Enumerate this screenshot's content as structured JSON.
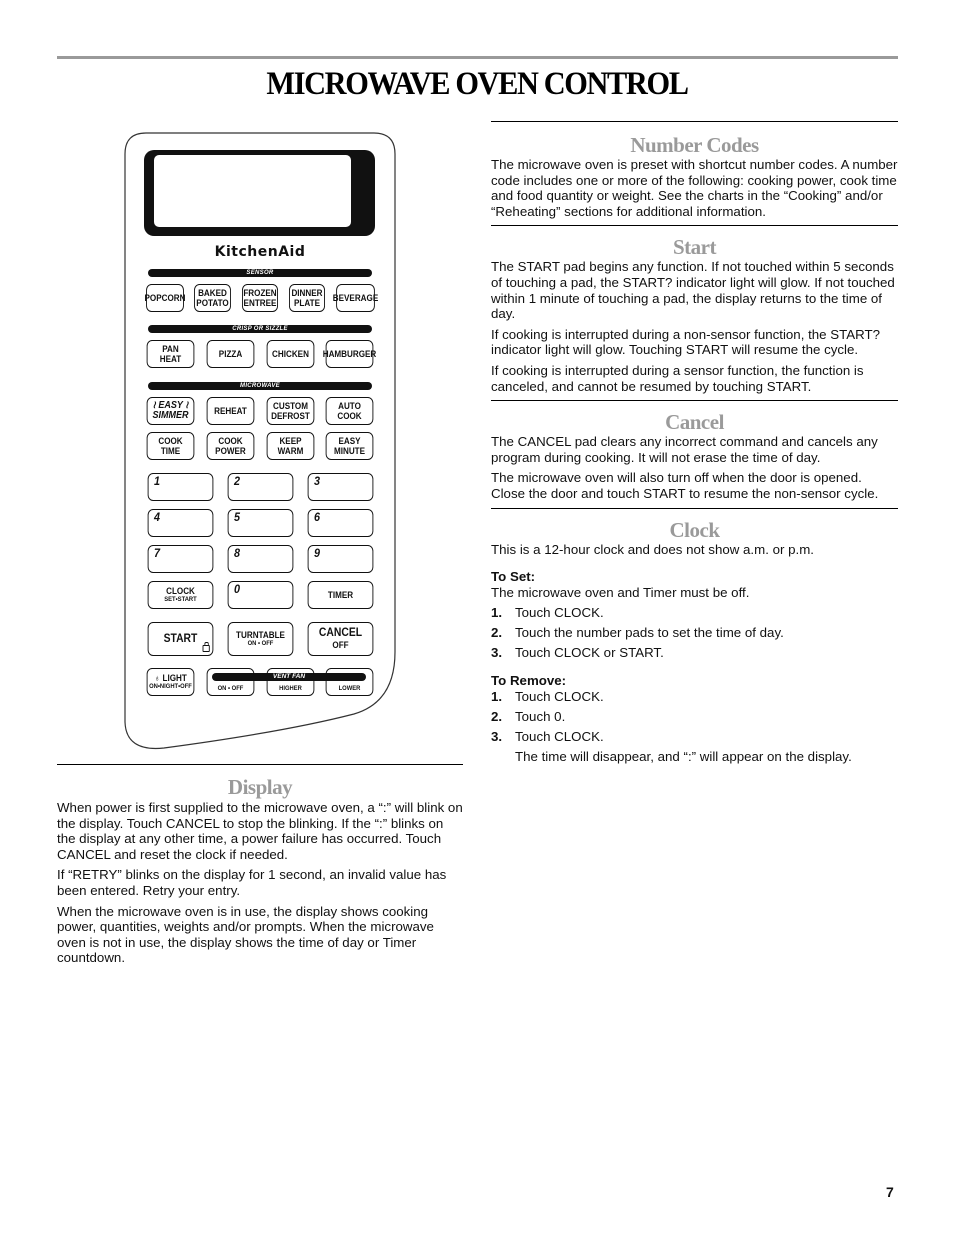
{
  "page": {
    "title": "MICROWAVE OVEN CONTROL",
    "page_number": "7"
  },
  "keypad": {
    "brand": "KitchenAid",
    "bands": {
      "sensor": "SENSOR",
      "crisp": "CRISP OR SIZZLE",
      "microwave": "MICROWAVE",
      "vent_fan": "VENT FAN"
    },
    "sensor_keys": [
      {
        "l1": "POPCORN",
        "l2": ""
      },
      {
        "l1": "BAKED",
        "l2": "POTATO"
      },
      {
        "l1": "FROZEN",
        "l2": "ENTREE"
      },
      {
        "l1": "DINNER",
        "l2": "PLATE"
      },
      {
        "l1": "BEVERAGE",
        "l2": ""
      }
    ],
    "crisp_keys": [
      {
        "l1": "PAN",
        "l2": "HEAT"
      },
      {
        "l1": "PIZZA",
        "l2": ""
      },
      {
        "l1": "CHICKEN",
        "l2": ""
      },
      {
        "l1": "HAMBURGER",
        "l2": ""
      }
    ],
    "microwave_keys_row1": [
      {
        "l1": "≀ EASY ≀",
        "l2": "SIMMER"
      },
      {
        "l1": "REHEAT",
        "l2": ""
      },
      {
        "l1": "CUSTOM",
        "l2": "DEFROST"
      },
      {
        "l1": "AUTO",
        "l2": "COOK"
      }
    ],
    "microwave_keys_row2": [
      {
        "l1": "COOK",
        "l2": "TIME"
      },
      {
        "l1": "COOK",
        "l2": "POWER"
      },
      {
        "l1": "KEEP",
        "l2": "WARM"
      },
      {
        "l1": "EASY",
        "l2": "MINUTE"
      }
    ],
    "numbers": [
      "1",
      "2",
      "3",
      "4",
      "5",
      "6",
      "7",
      "8",
      "9",
      "0"
    ],
    "clock": {
      "l1": "CLOCK",
      "l2": "SET•START"
    },
    "timer": "TIMER",
    "start": "START",
    "turntable": {
      "l1": "TURNTABLE",
      "l2": "ON • OFF"
    },
    "cancel": {
      "l1": "CANCEL",
      "l2": "OFF"
    },
    "light": {
      "l1": "LIGHT",
      "l2": "ON•NIGHT•OFF"
    },
    "vent_keys": [
      "ON • OFF",
      "HIGHER",
      "LOWER"
    ]
  },
  "display": {
    "title": "Display",
    "paragraphs": [
      "When power is first supplied to the microwave oven, a “:” will blink on the display. Touch CANCEL to stop the blinking. If the “:” blinks on the display at any other time, a power failure has occurred. Touch CANCEL and reset the clock if needed.",
      "If “RETRY” blinks on the display for 1 second, an invalid value has been entered. Retry your entry.",
      "When the microwave oven is in use, the display shows cooking power, quantities, weights and/or prompts. When the microwave oven is not in use, the display shows the time of day or Timer countdown."
    ]
  },
  "number_codes": {
    "title": "Number Codes",
    "paragraphs": [
      "The microwave oven is preset with shortcut number codes. A number code includes one or more of the following: cooking power, cook time and food quantity or weight. See the charts in the “Cooking” and/or “Reheating” sections for additional information."
    ]
  },
  "start": {
    "title": "Start",
    "paragraphs": [
      "The START pad begins any function. If not touched within 5 seconds of touching a pad, the START? indicator light will glow. If not touched within 1 minute of touching a pad, the display returns to the time of day.",
      "If cooking is interrupted during a non-sensor function, the START? indicator light will glow. Touching START will resume the cycle.",
      "If cooking is interrupted during a sensor function, the function is canceled, and cannot be resumed by touching START."
    ]
  },
  "cancel": {
    "title": "Cancel",
    "paragraphs": [
      "The CANCEL pad clears any incorrect command and cancels any program during cooking. It will not erase the time of day.",
      "The microwave oven will also turn off when the door is opened. Close the door and touch START to resume the non-sensor cycle."
    ]
  },
  "clock": {
    "title": "Clock",
    "intro": "This is a 12-hour clock and does not show a.m. or p.m.",
    "to_set": {
      "heading": "To Set:",
      "intro": "The microwave oven and Timer must be off.",
      "steps": [
        {
          "n": "1.",
          "text": "Touch CLOCK."
        },
        {
          "n": "2.",
          "text": "Touch the number pads to set the time of day."
        },
        {
          "n": "3.",
          "text": "Touch CLOCK or START."
        }
      ]
    },
    "to_remove": {
      "heading": "To Remove:",
      "steps": [
        {
          "n": "1.",
          "text": "Touch CLOCK."
        },
        {
          "n": "2.",
          "text": "Touch 0."
        },
        {
          "n": "3.",
          "text": "Touch CLOCK."
        }
      ],
      "note": "The time will disappear, and “:” will appear on the display."
    }
  }
}
